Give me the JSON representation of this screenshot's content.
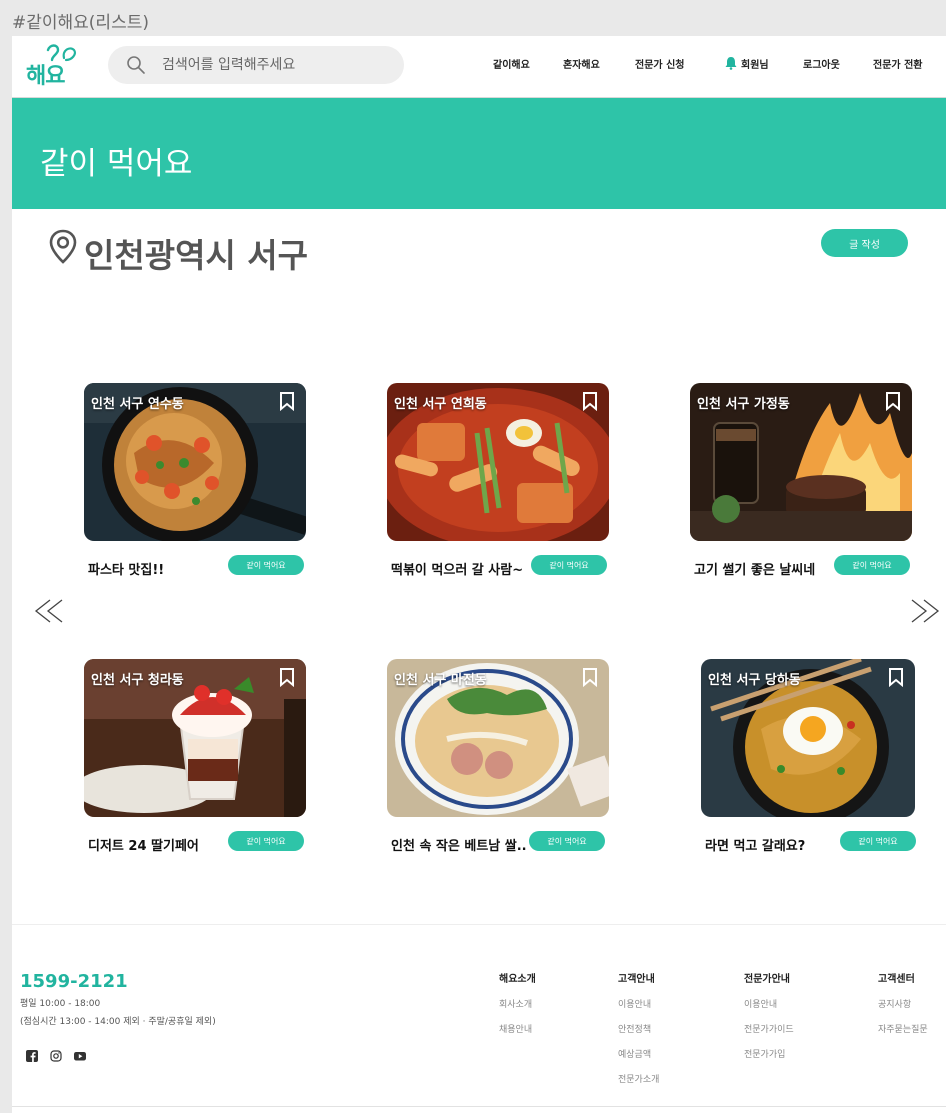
{
  "frame_label": "#같이해요(리스트)",
  "header": {
    "logo_text": "해요",
    "search_placeholder": "검색어를 입력해주세요",
    "nav": [
      "같이해요",
      "혼자해요",
      "전문가 신청",
      "회원님",
      "로그아웃",
      "전문가 전환"
    ]
  },
  "banner": {
    "title": "같이 먹어요"
  },
  "location": {
    "name": "인천광역시 서구",
    "write_button": "글 작성"
  },
  "posts": [
    {
      "location": "인천 서구 연수동",
      "title": "파스타 맛집!!",
      "button": "같이 먹어요",
      "image": "pasta"
    },
    {
      "location": "인천 서구 연희동",
      "title": "떡볶이 먹으러 갈 사람~",
      "button": "같이 먹어요",
      "image": "tteokbokki"
    },
    {
      "location": "인천 서구 가정동",
      "title": "고기 썰기 좋은 날씨네",
      "button": "같이 먹어요",
      "image": "steak"
    },
    {
      "location": "인천 서구 청라동",
      "title": "디저트 24 딸기페어",
      "button": "같이 먹어요",
      "image": "parfait"
    },
    {
      "location": "인천 서구 마전동",
      "title": "인천 속 작은 베트남 쌀..",
      "button": "같이 먹어요",
      "image": "pho"
    },
    {
      "location": "인천 서구 당하동",
      "title": "라면 먹고 갈래요?",
      "button": "같이 먹어요",
      "image": "ramen"
    }
  ],
  "footer": {
    "phone": "1599-2121",
    "hours": "평일 10:00 - 18:00",
    "lunch": "(점심시간 13:00 - 14:00 제외 · 주말/공휴일 제외)",
    "social": [
      "facebook-icon",
      "instagram-icon",
      "youtube-icon"
    ],
    "columns": [
      {
        "title": "해요소개",
        "items": [
          "회사소개",
          "채용안내"
        ]
      },
      {
        "title": "고객안내",
        "items": [
          "이용안내",
          "안전정책",
          "예상금액",
          "전문가소개"
        ]
      },
      {
        "title": "전문가안내",
        "items": [
          "이용안내",
          "전문가가이드",
          "전문가가입"
        ]
      },
      {
        "title": "고객센터",
        "items": [
          "공지사항",
          "자주묻는질문"
        ]
      }
    ]
  },
  "colors": {
    "accent": "#2ec4a8",
    "logo": "#21b49f"
  }
}
